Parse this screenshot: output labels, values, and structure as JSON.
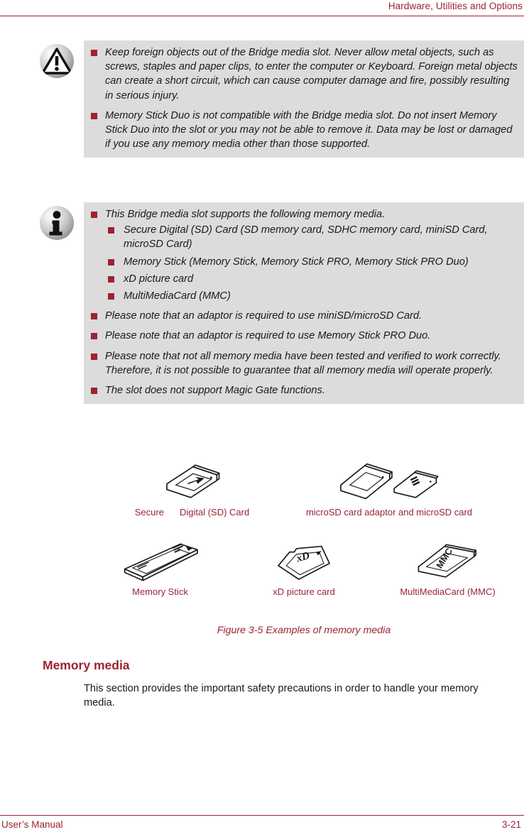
{
  "header": {
    "title": "Hardware, Utilities and Options"
  },
  "warning_panel": {
    "icon": "warning-triangle-icon",
    "bullets": [
      "Keep foreign objects out of the Bridge media slot. Never allow metal objects, such as screws, staples and paper clips, to enter the computer or Keyboard. Foreign metal objects can create a short circuit, which can cause computer damage and fire, possibly resulting in serious injury.",
      "Memory Stick Duo is not compatible with the Bridge media slot. Do not insert Memory Stick Duo into the slot or you may not be able to remove it. Data may be lost or damaged if you use any memory media other than those supported."
    ]
  },
  "info_panel": {
    "icon": "info-i-icon",
    "intro": "This Bridge media slot supports the following memory media.",
    "media_list": [
      "Secure Digital (SD) Card (SD memory card, SDHC memory card, miniSD Card, microSD Card)",
      "Memory Stick (Memory Stick, Memory Stick PRO, Memory Stick PRO Duo)",
      "xD picture card",
      "MultiMediaCard (MMC)"
    ],
    "notes": [
      "Please note that an adaptor is required to use miniSD/microSD Card.",
      "Please note that an adaptor is required to use Memory Stick PRO Duo.",
      "Please note that not all memory media have been tested and verified to work correctly. Therefore, it is not possible to guarantee that all memory media will operate properly.",
      "The slot does not support Magic Gate functions."
    ]
  },
  "figure": {
    "caption": "Figure 3-5 Examples of memory media",
    "cards": [
      {
        "label_a": "Secure",
        "label_b": "Digital (SD) Card",
        "art": "sd-card-art"
      },
      {
        "label_a": "",
        "label_b": "microSD card adaptor and microSD card",
        "art": "microsd-adaptor-art"
      },
      {
        "label_a": "",
        "label_b": "Memory Stick",
        "art": "memory-stick-art"
      },
      {
        "label_a": "",
        "label_b": "xD picture card",
        "art": "xd-card-art"
      },
      {
        "label_a": "",
        "label_b": "MultiMediaCard  (MMC)",
        "art": "mmc-card-art"
      }
    ]
  },
  "section": {
    "heading": "Memory media",
    "body": "This section provides the important safety precautions in order to handle your memory media."
  },
  "footer": {
    "left": "User’s Manual",
    "right": "3-21"
  },
  "colors": {
    "accent": "#9B2332",
    "panel_bg": "#DCDCDC",
    "text": "#1a1a1a"
  }
}
